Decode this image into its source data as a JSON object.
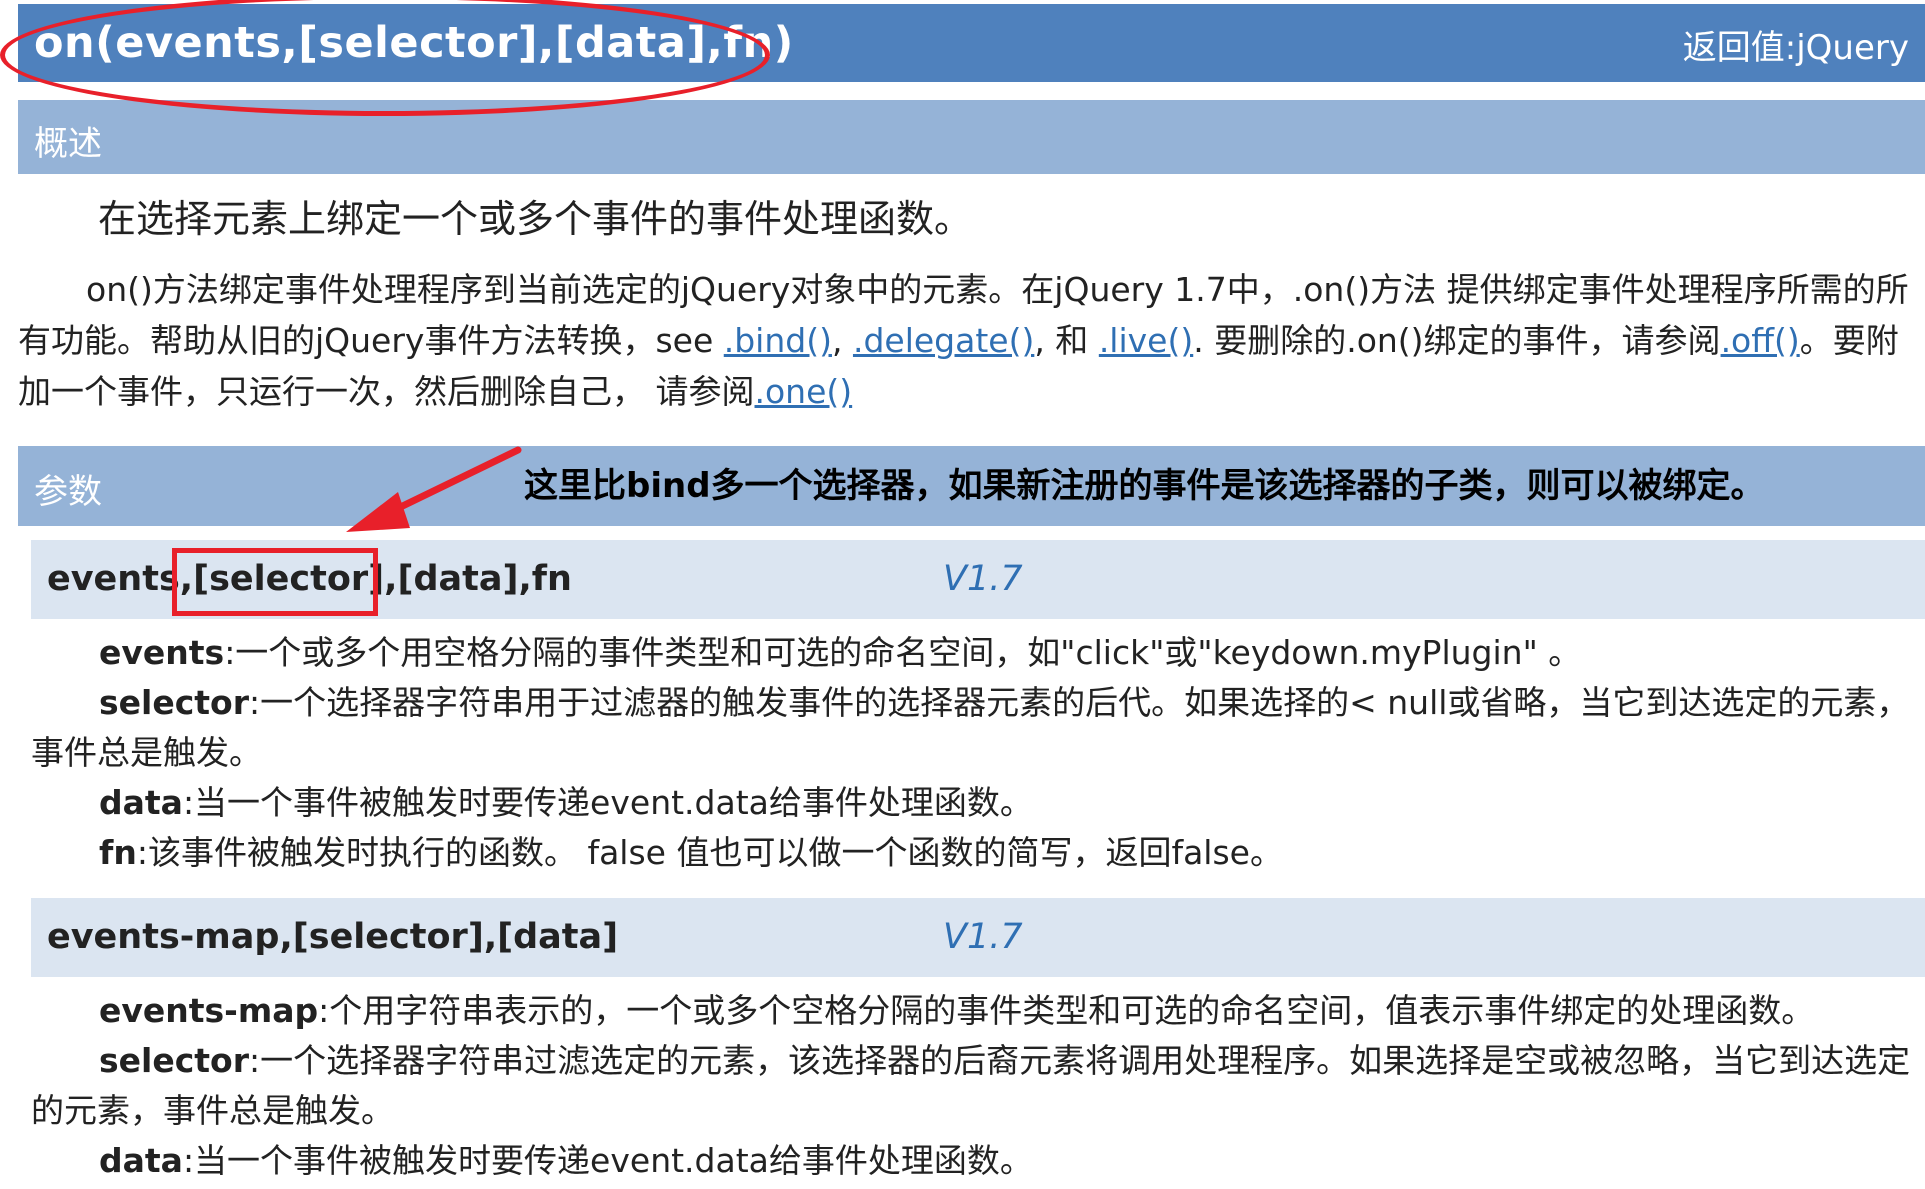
{
  "header": {
    "signature": "on(events,[selector],[data],fn)",
    "return_value": "返回值:jQuery"
  },
  "overview": {
    "label": "概述",
    "summary": "在选择元素上绑定一个或多个事件的事件处理函数。",
    "description": {
      "p1": "on()方法绑定事件处理程序到当前选定的jQuery对象中的元素。在jQuery 1.7中，.on()方法 提供绑定事件处理程序所需的所有功能。帮助从旧的jQuery事件方法转换，see ",
      "link_bind": ".bind()",
      "sep1": ", ",
      "link_delegate": ".delegate()",
      "sep2": ", 和 ",
      "link_live": ".live()",
      "p2": ". 要删除的.on()绑定的事件，请参阅",
      "link_off": ".off()",
      "p3": "。要附加一个事件，只运行一次，然后删除自己， 请参阅",
      "link_one": ".one()"
    }
  },
  "params": {
    "label": "参数",
    "annotation": "这里比bind多一个选择器，如果新注册的事件是该选择器的子类，则可以被绑定。",
    "signatures": [
      {
        "prefix": "events,",
        "highlight": "[selector]",
        "rest": ",[data],fn",
        "version": "V1.7",
        "items": [
          {
            "name": "events",
            "text": ":一个或多个用空格分隔的事件类型和可选的命名空间，如\"click\"或\"keydown.myPlugin\" 。"
          },
          {
            "name": "selector",
            "text": ":一个选择器字符串用于过滤器的触发事件的选择器元素的后代。如果选择的< null或省略，当它到达选定的元素，事件总是触发。"
          },
          {
            "name": "data",
            "text": ":当一个事件被触发时要传递event.data给事件处理函数。"
          },
          {
            "name": "fn",
            "text": ":该事件被触发时执行的函数。 false 值也可以做一个函数的简写，返回false。"
          }
        ]
      },
      {
        "text": "events-map,[selector],[data]",
        "version": "V1.7",
        "items": [
          {
            "name": "events-map",
            "text": ":个用字符串表示的，一个或多个空格分隔的事件类型和可选的命名空间，值表示事件绑定的处理函数。"
          },
          {
            "name": "selector",
            "text": ":一个选择器字符串过滤选定的元素，该选择器的后裔元素将调用处理程序。如果选择是空或被忽略，当它到达选定的元素，事件总是触发。"
          },
          {
            "name": "data",
            "text": ":当一个事件被触发时要传递event.data给事件处理函数。"
          }
        ]
      }
    ]
  },
  "colors": {
    "title_bar": "#4f81bd",
    "section_bar": "#95b3d7",
    "signature_bar": "#dbe5f1",
    "link": "#2f6fb3",
    "annotation_red": "#e8202a"
  }
}
